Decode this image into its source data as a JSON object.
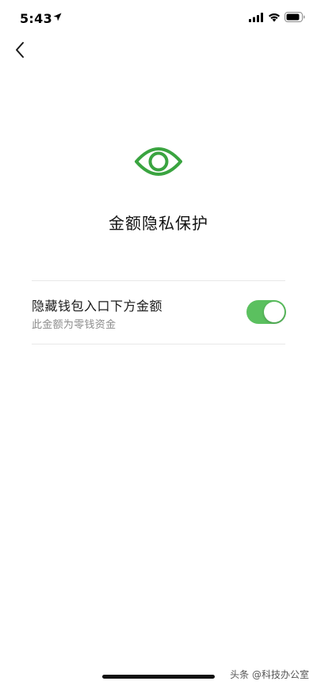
{
  "status_bar": {
    "time": "5:43",
    "icons": [
      "location-arrow-icon",
      "signal-bars-icon",
      "wifi-icon",
      "battery-icon"
    ]
  },
  "nav": {
    "back_icon": "chevron-left-icon"
  },
  "hero": {
    "icon": "eye-icon",
    "title": "金额隐私保护"
  },
  "setting": {
    "label": "隐藏钱包入口下方金额",
    "description": "此金额为零钱资金",
    "toggle_on": true
  },
  "watermark": "头条 @科技办公室",
  "colors": {
    "accent": "#5bc05f",
    "icon_green": "#3aa440",
    "text_primary": "#1a1a1a",
    "text_secondary": "#8c8c8c",
    "divider": "#e8e8e8"
  }
}
